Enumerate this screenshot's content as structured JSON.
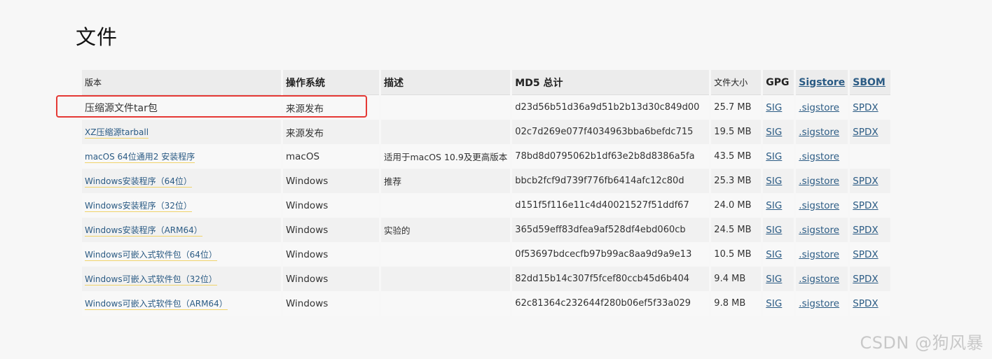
{
  "page": {
    "title": "文件"
  },
  "table": {
    "headers": {
      "version": "版本",
      "os": "操作系统",
      "description": "描述",
      "md5": "MD5 总计",
      "size": "文件大小",
      "gpg": "GPG",
      "sigstore": "Sigstore",
      "sbom": "SBOM"
    },
    "rows": [
      {
        "version": "压缩源文件tar包",
        "os": "来源发布",
        "description": "",
        "md5": "d23d56b51d36a9d51b2b13d30c849d00",
        "size": "25.7 MB",
        "gpg": "SIG",
        "sigstore": ".sigstore",
        "sbom": "SPDX"
      },
      {
        "version": "XZ压缩源tarball",
        "os": "来源发布",
        "description": "",
        "md5": "02c7d269e077f4034963bba6befdc715",
        "size": "19.5 MB",
        "gpg": "SIG",
        "sigstore": ".sigstore",
        "sbom": "SPDX"
      },
      {
        "version": "macOS 64位通用2 安装程序",
        "os": "macOS",
        "description": "适用于macOS 10.9及更高版本",
        "md5": "78bd8d0795062b1df63e2b8d8386a5fa",
        "size": "43.5 MB",
        "gpg": "SIG",
        "sigstore": ".sigstore",
        "sbom": ""
      },
      {
        "version": "Windows安装程序（64位）",
        "os": "Windows",
        "description": "推荐",
        "md5": "bbcb2fcf9d739f776fb6414afc12c80d",
        "size": "25.3 MB",
        "gpg": "SIG",
        "sigstore": ".sigstore",
        "sbom": "SPDX"
      },
      {
        "version": "Windows安装程序（32位）",
        "os": "Windows",
        "description": "",
        "md5": "d151f5f116e11c4d40021527f51ddf67",
        "size": "24.0 MB",
        "gpg": "SIG",
        "sigstore": ".sigstore",
        "sbom": "SPDX"
      },
      {
        "version": "Windows安装程序（ARM64）",
        "os": "Windows",
        "description": "实验的",
        "md5": "365d59eff83dfea9af528df4ebd060cb",
        "size": "24.5 MB",
        "gpg": "SIG",
        "sigstore": ".sigstore",
        "sbom": "SPDX"
      },
      {
        "version": "Windows可嵌入式软件包（64位）",
        "os": "Windows",
        "description": "",
        "md5": "0f53697bdcecfb97b99ac8aa9d9a9e13",
        "size": "10.5 MB",
        "gpg": "SIG",
        "sigstore": ".sigstore",
        "sbom": "SPDX"
      },
      {
        "version": "Windows可嵌入式软件包（32位）",
        "os": "Windows",
        "description": "",
        "md5": "82dd15b14c307f5fcef80ccb45d6b404",
        "size": "9.4 MB",
        "gpg": "SIG",
        "sigstore": ".sigstore",
        "sbom": "SPDX"
      },
      {
        "version": "Windows可嵌入式软件包（ARM64）",
        "os": "Windows",
        "description": "",
        "md5": "62c81364c232644f280b06ef5f33a029",
        "size": "9.8 MB",
        "gpg": "SIG",
        "sigstore": ".sigstore",
        "sbom": "SPDX"
      }
    ]
  },
  "watermark": "CSDN @狗风暴",
  "colors": {
    "link": "#2b5b84",
    "highlight": "#e53935",
    "underline": "#f0d36a"
  }
}
